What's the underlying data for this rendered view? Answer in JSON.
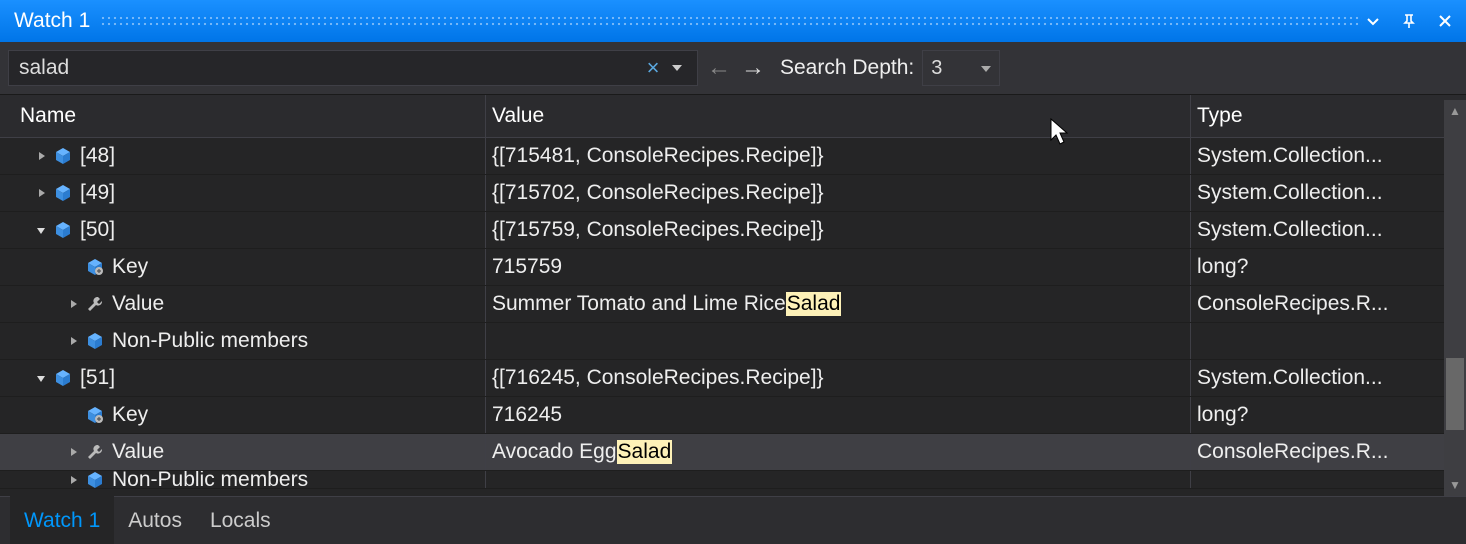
{
  "window": {
    "title": "Watch 1"
  },
  "search": {
    "query": "salad",
    "depth_label": "Search Depth:",
    "depth_value": "3"
  },
  "headers": {
    "name": "Name",
    "value": "Value",
    "type": "Type"
  },
  "rows": [
    {
      "indent": 1,
      "expander": "collapsed",
      "icon": "cube",
      "name": "[48]",
      "value": "{[715481, ConsoleRecipes.Recipe]}",
      "type": "System.Collection...",
      "selected": false
    },
    {
      "indent": 1,
      "expander": "collapsed",
      "icon": "cube",
      "name": "[49]",
      "value": "{[715702, ConsoleRecipes.Recipe]}",
      "type": "System.Collection...",
      "selected": false
    },
    {
      "indent": 1,
      "expander": "expanded",
      "icon": "cube",
      "name": "[50]",
      "value": "{[715759, ConsoleRecipes.Recipe]}",
      "type": "System.Collection...",
      "selected": false
    },
    {
      "indent": 2,
      "expander": "none",
      "icon": "prop",
      "name": "Key",
      "value": "715759",
      "type": "long?",
      "selected": false
    },
    {
      "indent": 2,
      "expander": "collapsed",
      "icon": "wrench",
      "name": "Value",
      "value": "Summer Tomato and Lime Rice ",
      "highlight": "Salad",
      "type": "ConsoleRecipes.R...",
      "selected": false
    },
    {
      "indent": 2,
      "expander": "collapsed",
      "icon": "cube",
      "name": "Non-Public members",
      "value": "",
      "type": "",
      "selected": false
    },
    {
      "indent": 1,
      "expander": "expanded",
      "icon": "cube",
      "name": "[51]",
      "value": "{[716245, ConsoleRecipes.Recipe]}",
      "type": "System.Collection...",
      "selected": false
    },
    {
      "indent": 2,
      "expander": "none",
      "icon": "prop",
      "name": "Key",
      "value": "716245",
      "type": "long?",
      "selected": false
    },
    {
      "indent": 2,
      "expander": "collapsed",
      "icon": "wrench",
      "name": "Value",
      "value": "Avocado Egg ",
      "highlight": "Salad",
      "type": "ConsoleRecipes.R...",
      "selected": true
    },
    {
      "indent": 2,
      "expander": "collapsed",
      "icon": "cube",
      "name": "Non-Public members",
      "value": "",
      "type": "",
      "selected": false,
      "clipped": true
    }
  ],
  "tabs": [
    {
      "label": "Watch 1",
      "active": true
    },
    {
      "label": "Autos",
      "active": false
    },
    {
      "label": "Locals",
      "active": false
    }
  ]
}
